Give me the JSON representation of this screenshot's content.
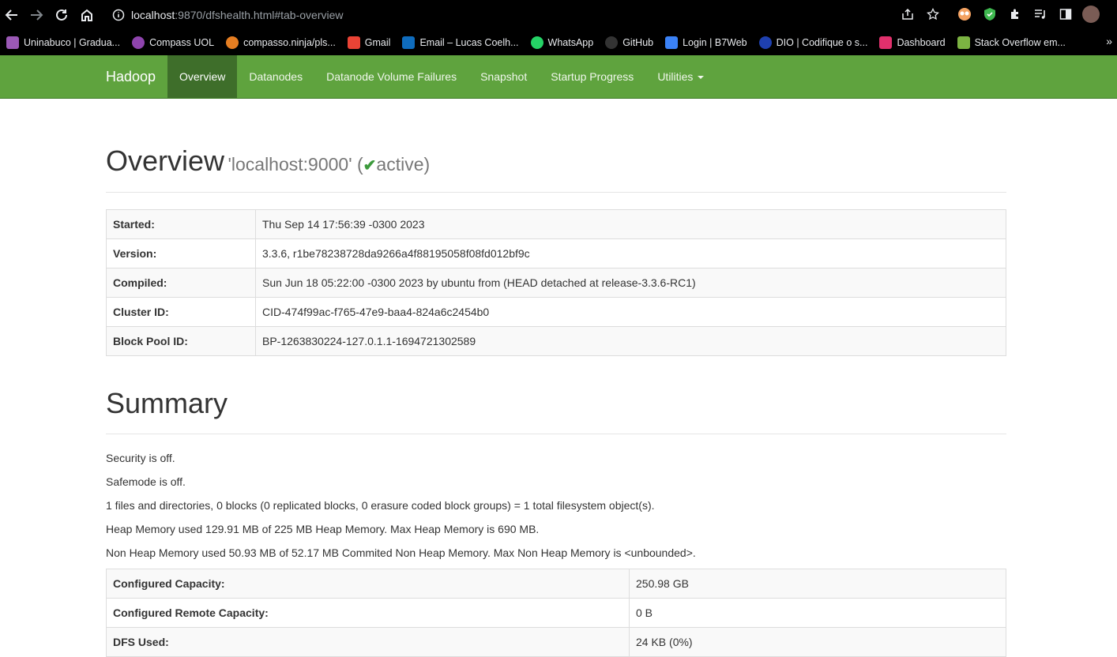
{
  "browser": {
    "url_host": "localhost",
    "url_path": ":9870/dfshealth.html#tab-overview"
  },
  "bookmarks": [
    {
      "label": "Uninabuco | Gradua...",
      "color": "#9b59b6"
    },
    {
      "label": "Compass UOL",
      "color": "#8e44ad"
    },
    {
      "label": "compasso.ninja/pls...",
      "color": "#e67e22"
    },
    {
      "label": "Gmail",
      "color": "#ea4335"
    },
    {
      "label": "Email – Lucas Coelh...",
      "color": "#0f6cbd"
    },
    {
      "label": "WhatsApp",
      "color": "#25d366"
    },
    {
      "label": "GitHub",
      "color": "#333333"
    },
    {
      "label": "Login | B7Web",
      "color": "#3b82f6"
    },
    {
      "label": "DIO | Codifique o s...",
      "color": "#1e40af"
    },
    {
      "label": "Dashboard",
      "color": "#e1306c"
    },
    {
      "label": "Stack Overflow em...",
      "color": "#7cb342"
    }
  ],
  "nav": {
    "brand": "Hadoop",
    "items": [
      "Overview",
      "Datanodes",
      "Datanode Volume Failures",
      "Snapshot",
      "Startup Progress",
      "Utilities"
    ],
    "active_index": 0
  },
  "overview": {
    "title": "Overview",
    "host": "'localhost:9000' (",
    "status": "active",
    "close": ")",
    "rows": [
      {
        "label": "Started:",
        "value": "Thu Sep 14 17:56:39 -0300 2023"
      },
      {
        "label": "Version:",
        "value": "3.3.6, r1be78238728da9266a4f88195058f08fd012bf9c"
      },
      {
        "label": "Compiled:",
        "value": "Sun Jun 18 05:22:00 -0300 2023 by ubuntu from (HEAD detached at release-3.3.6-RC1)"
      },
      {
        "label": "Cluster ID:",
        "value": "CID-474f99ac-f765-47e9-baa4-824a6c2454b0"
      },
      {
        "label": "Block Pool ID:",
        "value": "BP-1263830224-127.0.1.1-1694721302589"
      }
    ]
  },
  "summary": {
    "title": "Summary",
    "lines": [
      "Security is off.",
      "Safemode is off.",
      "1 files and directories, 0 blocks (0 replicated blocks, 0 erasure coded block groups) = 1 total filesystem object(s).",
      "Heap Memory used 129.91 MB of 225 MB Heap Memory. Max Heap Memory is 690 MB.",
      "Non Heap Memory used 50.93 MB of 52.17 MB Commited Non Heap Memory. Max Non Heap Memory is <unbounded>."
    ],
    "rows": [
      {
        "label": "Configured Capacity:",
        "value": "250.98 GB"
      },
      {
        "label": "Configured Remote Capacity:",
        "value": "0 B"
      },
      {
        "label": "DFS Used:",
        "value": "24 KB (0%)"
      }
    ]
  }
}
